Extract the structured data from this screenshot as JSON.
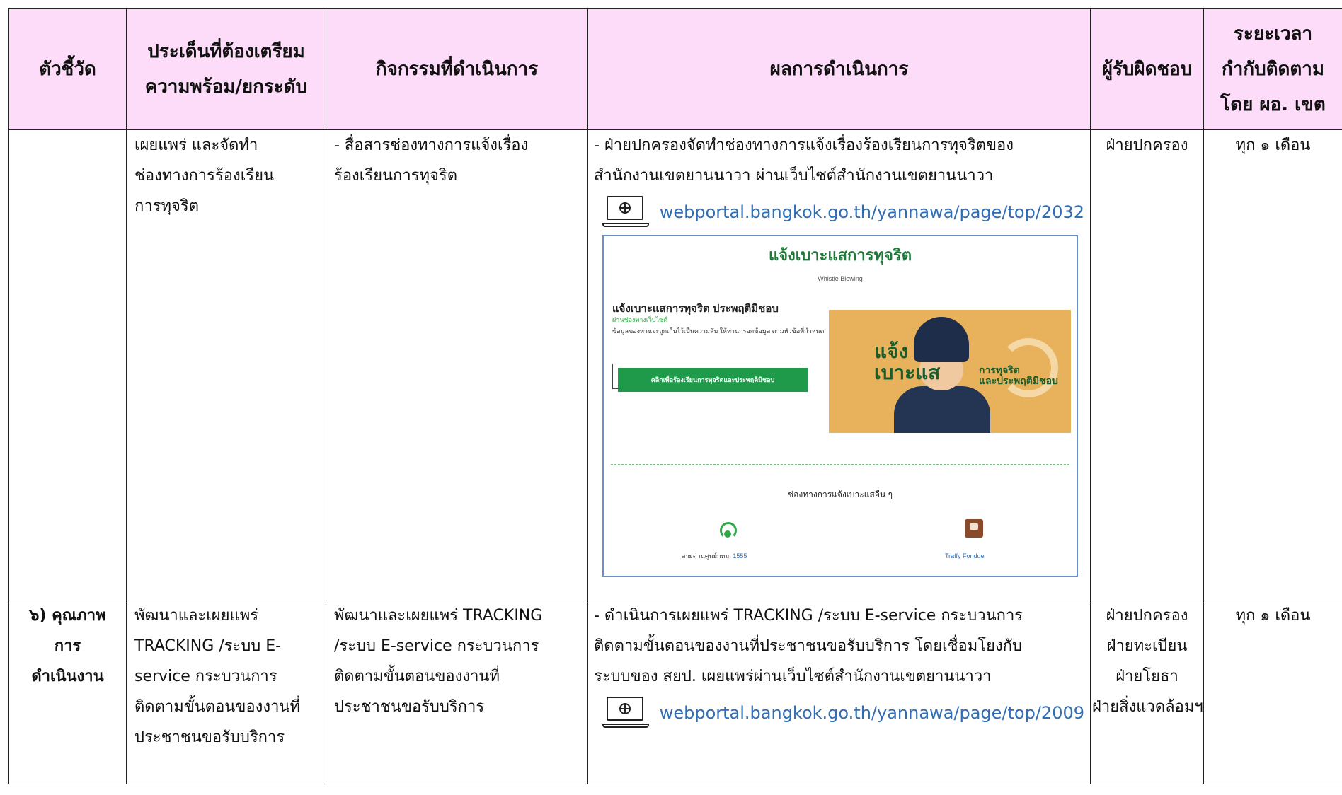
{
  "headers": {
    "indicator": [
      "ตัวชี้วัด"
    ],
    "issue": [
      "ประเด็นที่ต้องเตรียม",
      "ความพร้อม/ยกระดับ"
    ],
    "activity": [
      "กิจกรรมที่ดำเนินการ"
    ],
    "result": [
      "ผลการดำเนินการ"
    ],
    "responsible": [
      "ผู้รับผิดชอบ"
    ],
    "period": [
      "ระยะเวลา",
      "กำกับติดตาม",
      "โดย ผอ. เขต"
    ]
  },
  "row1": {
    "indicator": "",
    "issue": [
      "เผยแพร่ และจัดทำ",
      "ช่องทางการร้องเรียน",
      "การทุจริต"
    ],
    "activity": [
      "- สื่อสารช่องทางการแจ้งเรื่อง",
      "ร้องเรียนการทุจริต"
    ],
    "result": [
      "- ฝ่ายปกครองจัดทำช่องทางการแจ้งเรื่องร้องเรียนการทุจริตของ",
      "สำนักงานเขตยานนาวา ผ่านเว็บไซต์สำนักงานเขตยานนาวา"
    ],
    "link": "webportal.bangkok.go.th/yannawa/page/top/2032",
    "responsible": [
      "ฝ่ายปกครอง"
    ],
    "period": "ทุก ๑ เดือน"
  },
  "embedded_page": {
    "title": "แจ้งเบาะแสการทุจริต",
    "subtitle": "Whistle Blowing",
    "heading": "แจ้งเบาะแสการทุจริต ประพฤติมิชอบ",
    "channel_note": "ผ่านช่องทางเว็บไซต์",
    "description": "ข้อมูลของท่านจะถูกเก็บไว้เป็นความลับ ให้ท่านกรอกข้อมูล ตามหัวข้อที่กำหนด",
    "button": "คลิกเพื่อร้องเรียนการทุจริตและประพฤติมิชอบ",
    "banner_big": [
      "แจ้ง",
      "เบาะแส"
    ],
    "banner_small": [
      "การทุจริต",
      "และประพฤติมิชอบ"
    ],
    "other_channels": "ช่องทางการแจ้งเบาะแสอื่น ๆ",
    "hotline_label": "สายด่วนศูนย์กทม.",
    "hotline_number": "1555",
    "traffy_label": "Traffy Fondue"
  },
  "row2": {
    "indicator": [
      "๖) คุณภาพ",
      "การ",
      "ดำเนินงาน"
    ],
    "issue": [
      "พัฒนาและเผยแพร่",
      "TRACKING /ระบบ E-",
      "service กระบวนการ",
      "ติดตามขั้นตอนของงานที่",
      "ประชาชนขอรับบริการ"
    ],
    "activity": [
      "พัฒนาและเผยแพร่ TRACKING",
      "/ระบบ E-service กระบวนการ",
      "ติดตามขั้นตอนของงานที่",
      "ประชาชนขอรับบริการ"
    ],
    "result": [
      "- ดำเนินการเผยแพร่ TRACKING /ระบบ E-service กระบวนการ",
      "ติดตามขั้นตอนของงานที่ประชาชนขอรับบริการ โดยเชื่อมโยงกับ",
      "ระบบของ สยป. เผยแพร่ผ่านเว็บไซต์สำนักงานเขตยานนาวา"
    ],
    "link": "webportal.bangkok.go.th/yannawa/page/top/2009",
    "responsible": [
      "ฝ่ายปกครอง",
      "ฝ่ายทะเบียน",
      "ฝ่ายโยธา",
      "ฝ่ายสิ่งแวดล้อมฯ"
    ],
    "period": "ทุก ๑ เดือน"
  },
  "colors": {
    "header_bg": "#fcdcf9",
    "link": "#2f6db5",
    "embedded_accent": "#1f7a3a"
  }
}
